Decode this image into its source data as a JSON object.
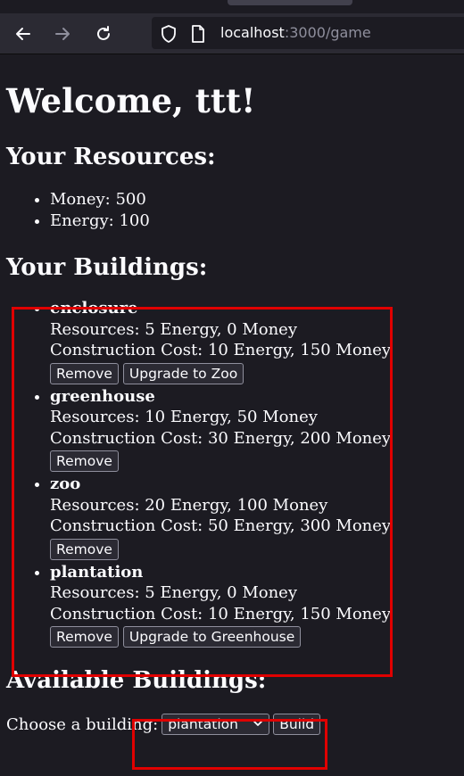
{
  "browser": {
    "url_host": "localhost",
    "url_rest": ":3000/game"
  },
  "page": {
    "welcome": "Welcome, ttt!"
  },
  "resources": {
    "heading": "Your Resources:",
    "items": [
      "Money: 500",
      "Energy: 100"
    ]
  },
  "buildings": {
    "heading": "Your Buildings:",
    "items": [
      {
        "name": "enclosure",
        "resources": "Resources: 5 Energy, 0 Money",
        "cost": "Construction Cost: 10 Energy, 150 Money",
        "remove_label": "Remove",
        "upgrade_label": "Upgrade to Zoo"
      },
      {
        "name": "greenhouse",
        "resources": "Resources: 10 Energy, 50 Money",
        "cost": "Construction Cost: 30 Energy, 200 Money",
        "remove_label": "Remove"
      },
      {
        "name": "zoo",
        "resources": "Resources: 20 Energy, 100 Money",
        "cost": "Construction Cost: 50 Energy, 300 Money",
        "remove_label": "Remove"
      },
      {
        "name": "plantation",
        "resources": "Resources: 5 Energy, 0 Money",
        "cost": "Construction Cost: 10 Energy, 150 Money",
        "remove_label": "Remove",
        "upgrade_label": "Upgrade to Greenhouse"
      }
    ]
  },
  "available": {
    "heading": "Available Buildings:",
    "choose_label": "Choose a building:",
    "selected": "plantation",
    "build_label": "Build"
  },
  "colors": {
    "background": "#1c1b22",
    "annotation": "#e00000"
  }
}
